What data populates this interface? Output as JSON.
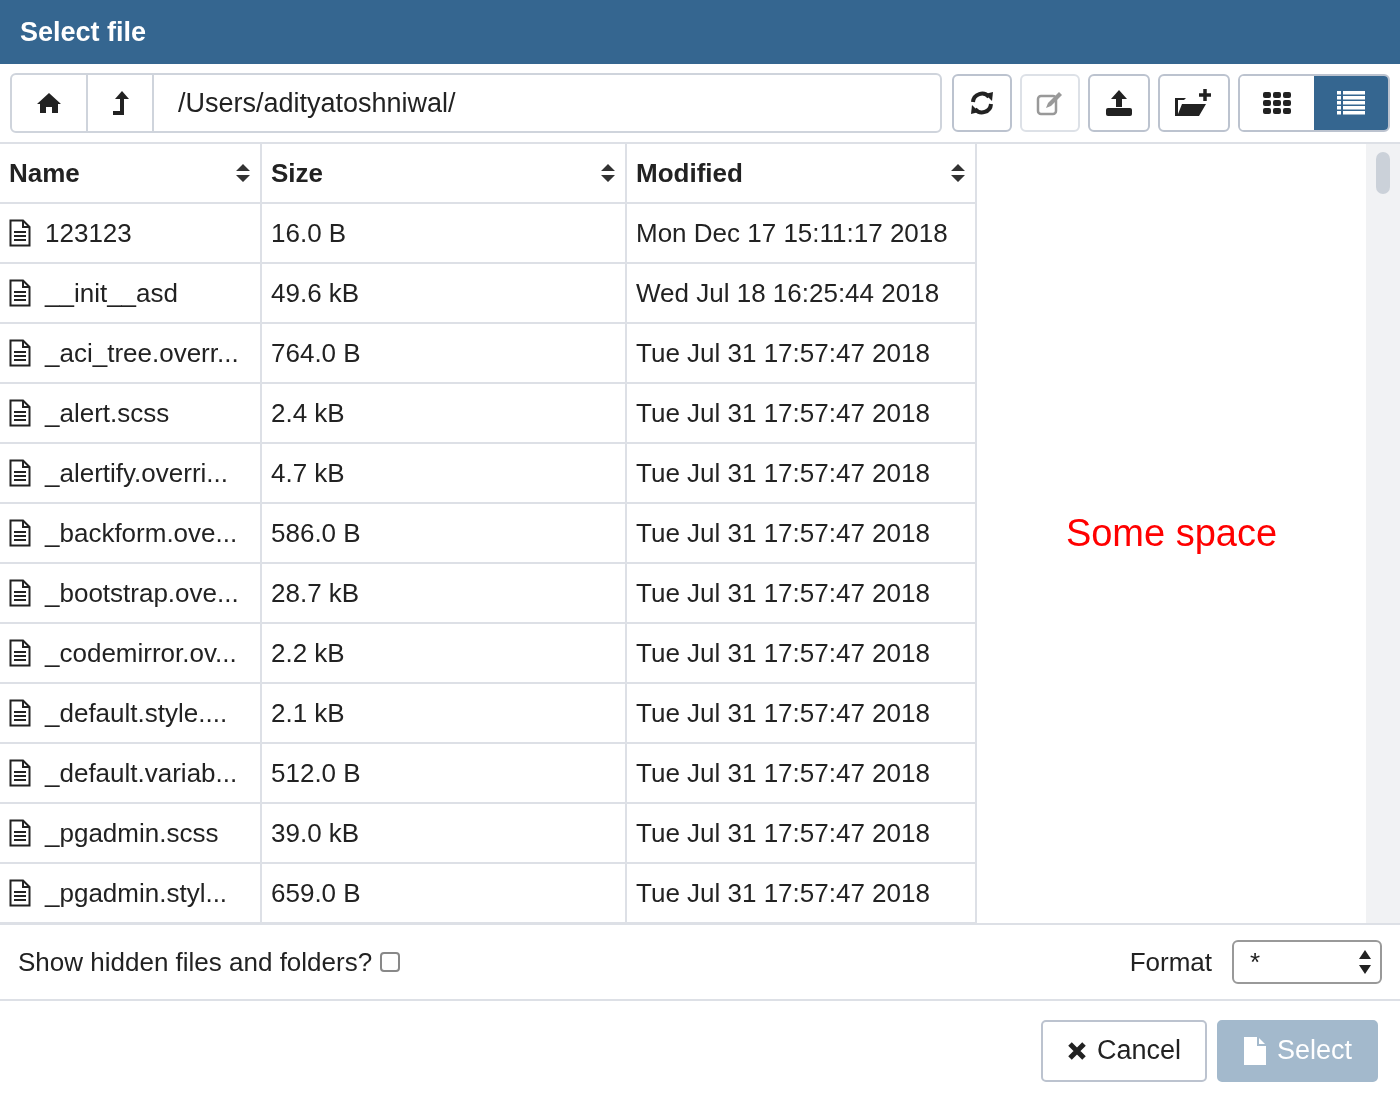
{
  "window": {
    "title": "Select file"
  },
  "toolbar": {
    "nav": [
      {
        "kind": "home"
      },
      {
        "kind": "up"
      }
    ],
    "path": "/Users/adityatoshniwal/",
    "actions": [
      {
        "kind": "refresh",
        "disabled": false
      },
      {
        "kind": "rename",
        "disabled": true
      },
      {
        "kind": "upload",
        "disabled": false
      },
      {
        "kind": "new-folder",
        "disabled": false
      }
    ],
    "views": [
      {
        "kind": "grid",
        "selected": false
      },
      {
        "kind": "list",
        "selected": true
      }
    ]
  },
  "table": {
    "columns": [
      "Name",
      "Size",
      "Modified"
    ],
    "rows": [
      {
        "name": "123123",
        "size": "16.0 B",
        "modified": "Mon Dec 17 15:11:17 2018"
      },
      {
        "name": "__init__asd",
        "size": "49.6 kB",
        "modified": "Wed Jul 18 16:25:44 2018"
      },
      {
        "name": "_aci_tree.overr...",
        "size": "764.0 B",
        "modified": "Tue Jul 31 17:57:47 2018"
      },
      {
        "name": "_alert.scss",
        "size": "2.4 kB",
        "modified": "Tue Jul 31 17:57:47 2018"
      },
      {
        "name": "_alertify.overri...",
        "size": "4.7 kB",
        "modified": "Tue Jul 31 17:57:47 2018"
      },
      {
        "name": "_backform.ove...",
        "size": "586.0 B",
        "modified": "Tue Jul 31 17:57:47 2018"
      },
      {
        "name": "_bootstrap.ove...",
        "size": "28.7 kB",
        "modified": "Tue Jul 31 17:57:47 2018"
      },
      {
        "name": "_codemirror.ov...",
        "size": "2.2 kB",
        "modified": "Tue Jul 31 17:57:47 2018"
      },
      {
        "name": "_default.style....",
        "size": "2.1 kB",
        "modified": "Tue Jul 31 17:57:47 2018"
      },
      {
        "name": "_default.variab...",
        "size": "512.0 B",
        "modified": "Tue Jul 31 17:57:47 2018"
      },
      {
        "name": "_pgadmin.scss",
        "size": "39.0 kB",
        "modified": "Tue Jul 31 17:57:47 2018"
      },
      {
        "name": "_pgadmin.styl...",
        "size": "659.0 B",
        "modified": "Tue Jul 31 17:57:47 2018"
      }
    ]
  },
  "annotation": "Some space",
  "options": {
    "hidden_label": "Show hidden files and folders?",
    "hidden_checked": false,
    "format_label": "Format",
    "format_value": "*"
  },
  "buttons": [
    {
      "kind": "cancel",
      "label": "Cancel",
      "disabled": false
    },
    {
      "kind": "select",
      "label": "Select",
      "disabled": true
    }
  ]
}
